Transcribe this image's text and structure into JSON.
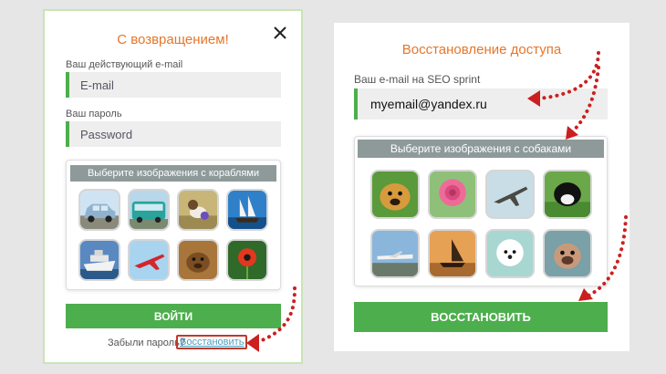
{
  "login": {
    "title": "С возвращением!",
    "email_label": "Ваш действующий e-mail",
    "email_placeholder": "E-mail",
    "password_label": "Ваш пароль",
    "password_placeholder": "Password",
    "captcha_title": "Выберите изображения с кораблями",
    "captcha_images": [
      "car",
      "bus",
      "dog",
      "sailing-ship",
      "cruise-ship",
      "jet-plane",
      "bear",
      "flower"
    ],
    "submit_label": "ВОЙТИ",
    "forgot_text": "Забыли пароль?",
    "restore_link": "Восстановить"
  },
  "restore": {
    "title": "Восстановление доступа",
    "email_label": "Ваш e-mail на SEO sprint",
    "email_value": "myemail@yandex.ru",
    "captcha_title": "Выберите изображения с собаками",
    "captcha_images": [
      "dog",
      "rose",
      "airplane",
      "cow",
      "small-plane",
      "boat",
      "white-dog",
      "pug"
    ],
    "submit_label": "ВОССТАНОВИТЬ"
  },
  "colors": {
    "accent_green": "#4cae4c",
    "title_orange": "#e6762a",
    "highlight_red": "#c0392b",
    "captcha_header": "#8e9a9a"
  }
}
